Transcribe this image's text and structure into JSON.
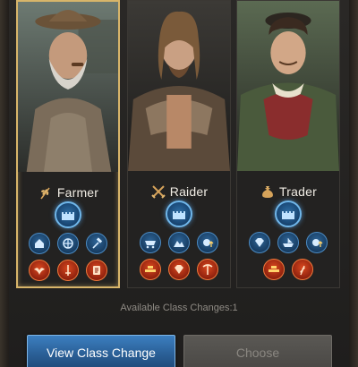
{
  "classes": [
    {
      "name": "Farmer",
      "icon": "wheat-icon",
      "selected": true,
      "main_skill": "castle-icon",
      "skills_row1": [
        "house-icon",
        "wheel-icon",
        "hammer-icon"
      ],
      "skills_row2": [
        "eagle-icon",
        "sword-icon",
        "scroll-icon"
      ]
    },
    {
      "name": "Raider",
      "icon": "crossed-swords-icon",
      "selected": false,
      "main_skill": "castle-icon",
      "skills_row1": [
        "cart-icon",
        "mountain-icon",
        "resource-up-icon"
      ],
      "skills_row2": [
        "gold-bars-icon",
        "gem-icon",
        "pickaxe-icon"
      ]
    },
    {
      "name": "Trader",
      "icon": "money-bag-icon",
      "selected": false,
      "main_skill": "castle-icon",
      "skills_row1": [
        "gem-icon",
        "boat-icon",
        "resource-up-icon"
      ],
      "skills_row2": [
        "gold-bars-icon",
        "grain-icon"
      ]
    }
  ],
  "available_text": "Available Class Changes:1",
  "buttons": {
    "view": "View Class Change",
    "choose": "Choose"
  },
  "colors": {
    "selected_border": "#d8b56a",
    "primary_button": "#3c7fc0",
    "disabled_button": "#5a5854"
  }
}
